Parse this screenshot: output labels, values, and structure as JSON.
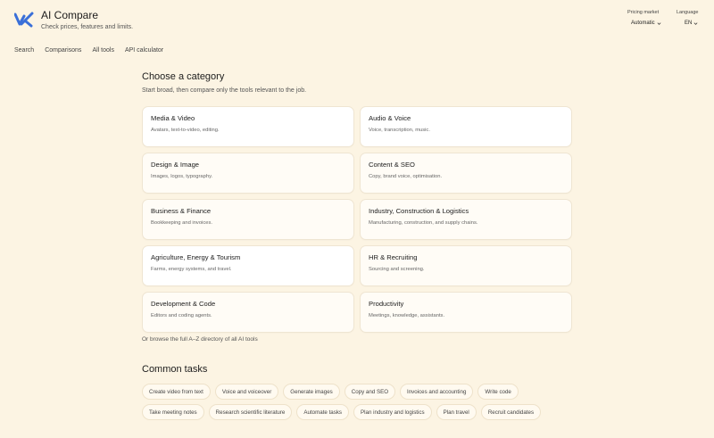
{
  "header": {
    "title": "AI Compare",
    "subtitle": "Check prices, features and limits.",
    "pricing_market_label": "Pricing market",
    "pricing_market_value": "Automatic",
    "language_label": "Language",
    "language_value": "EN",
    "brand_color": "#3a6fd8"
  },
  "nav": {
    "items": [
      "Search",
      "Comparisons",
      "All tools",
      "API calculator"
    ]
  },
  "categories": {
    "title": "Choose a category",
    "subtitle": "Start broad, then compare only the tools relevant to the job.",
    "items": [
      {
        "title": "Media & Video",
        "desc": "Avatars, text-to-video, editing."
      },
      {
        "title": "Audio & Voice",
        "desc": "Voice, transcription, music."
      },
      {
        "title": "Design & Image",
        "desc": "Images, logos, typography."
      },
      {
        "title": "Content & SEO",
        "desc": "Copy, brand voice, optimisation."
      },
      {
        "title": "Business & Finance",
        "desc": "Bookkeeping and invoices."
      },
      {
        "title": "Industry, Construction & Logistics",
        "desc": "Manufacturing, construction, and supply chains."
      },
      {
        "title": "Agriculture, Energy & Tourism",
        "desc": "Farms, energy systems, and travel."
      },
      {
        "title": "HR & Recruiting",
        "desc": "Sourcing and screening."
      },
      {
        "title": "Development & Code",
        "desc": "Editors and coding agents."
      },
      {
        "title": "Productivity",
        "desc": "Meetings, knowledge, assistants."
      }
    ],
    "browse_link": "Or browse the full A–Z directory of all AI tools"
  },
  "tasks": {
    "title": "Common tasks",
    "items": [
      "Create video from text",
      "Voice and voiceover",
      "Generate images",
      "Copy and SEO",
      "Invoices and accounting",
      "Write code",
      "Take meeting notes",
      "Research scientific literature",
      "Automate tasks",
      "Plan industry and logistics",
      "Plan travel",
      "Recruit candidates"
    ]
  }
}
